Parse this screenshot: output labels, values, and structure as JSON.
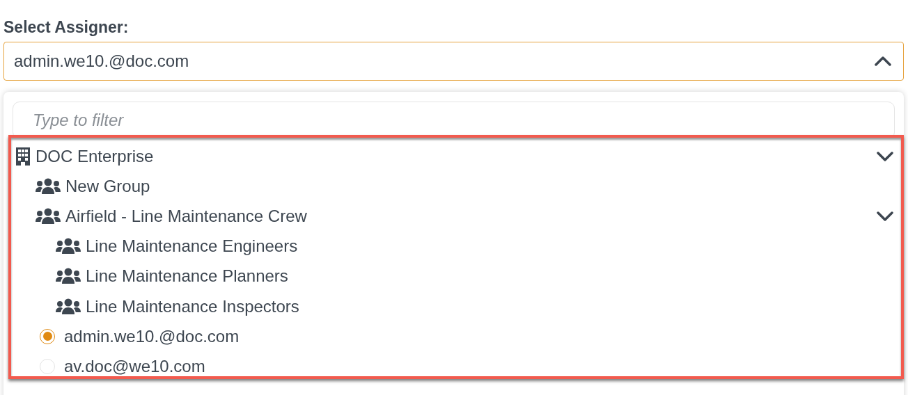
{
  "label": "Select Assigner:",
  "select": {
    "value": "admin.we10.@doc.com",
    "open": true
  },
  "filter": {
    "placeholder": "Type to filter"
  },
  "tree": {
    "items": [
      {
        "kind": "enterprise",
        "label": "DOC Enterprise",
        "expanded": true,
        "children": [
          {
            "kind": "group",
            "label": "New Group"
          },
          {
            "kind": "group",
            "label": "Airfield - Line Maintenance Crew",
            "expanded": true,
            "children": [
              {
                "kind": "group",
                "label": "Line Maintenance Engineers"
              },
              {
                "kind": "group",
                "label": "Line Maintenance Planners"
              },
              {
                "kind": "group",
                "label": "Line Maintenance Inspectors"
              }
            ]
          },
          {
            "kind": "user",
            "label": "admin.we10.@doc.com",
            "selected": true
          },
          {
            "kind": "user",
            "label": "av.doc@we10.com",
            "selected": false
          }
        ]
      }
    ]
  }
}
